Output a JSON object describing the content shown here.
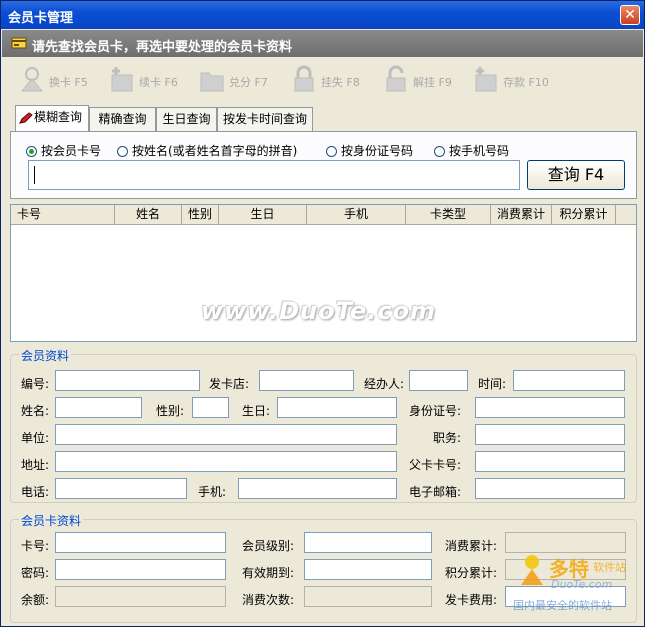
{
  "window": {
    "title": "会员卡管理",
    "close_symbol": "✕"
  },
  "banner": {
    "text": "请先查找会员卡，再选中要处理的会员卡资料"
  },
  "toolbar": [
    {
      "label": "换卡 F5",
      "icon": "swap-card-icon"
    },
    {
      "label": "续卡 F6",
      "icon": "renew-card-icon"
    },
    {
      "label": "兑分 F7",
      "icon": "redeem-points-icon"
    },
    {
      "label": "挂失 F8",
      "icon": "lock-icon"
    },
    {
      "label": "解挂 F9",
      "icon": "unlock-icon"
    },
    {
      "label": "存款 F10",
      "icon": "deposit-icon"
    }
  ],
  "tabs": [
    {
      "label": "模糊查询",
      "active": true
    },
    {
      "label": "精确查询",
      "active": false
    },
    {
      "label": "生日查询",
      "active": false
    },
    {
      "label": "按发卡时间查询",
      "active": false
    }
  ],
  "search": {
    "options": [
      {
        "label": "按会员卡号",
        "selected": true
      },
      {
        "label": "按姓名(或者姓名首字母的拼音)",
        "selected": false
      },
      {
        "label": "按身份证号码",
        "selected": false
      },
      {
        "label": "按手机号码",
        "selected": false
      }
    ],
    "value": "",
    "button_label": "查询 F4"
  },
  "grid": {
    "columns": [
      "卡号",
      "姓名",
      "性别",
      "生日",
      "手机",
      "卡类型",
      "消费累计",
      "积分累计"
    ]
  },
  "watermark": "www.DuoTe.com",
  "member_info": {
    "legend": "会员资料",
    "number_label": "编号:",
    "store_label": "发卡店:",
    "handler_label": "经办人:",
    "time_label": "时间:",
    "name_label": "姓名:",
    "gender_label": "性别:",
    "birthday_label": "生日:",
    "id_label": "身份证号:",
    "company_label": "单位:",
    "position_label": "职务:",
    "address_label": "地址:",
    "parent_card_label": "父卡卡号:",
    "phone_label": "电话:",
    "mobile_label": "手机:",
    "email_label": "电子邮箱:"
  },
  "card_info": {
    "legend": "会员卡资料",
    "card_no_label": "卡号:",
    "level_label": "会员级别:",
    "consume_total_label": "消费累计:",
    "password_label": "密码:",
    "expire_label": "有效期到:",
    "points_total_label": "积分累计:",
    "balance_label": "余额:",
    "consume_count_label": "消费次数:",
    "fee_label": "发卡费用:"
  },
  "corner_logo": {
    "brand": "多特",
    "sub": "软件站",
    "domain": "DuoTe.com",
    "slogan": "国内最安全的软件站"
  },
  "colors": {
    "titlebar": "#0a4fd4",
    "banner": "#7a7a7a",
    "legend": "#0046d5",
    "radio_dot": "#21a121"
  }
}
